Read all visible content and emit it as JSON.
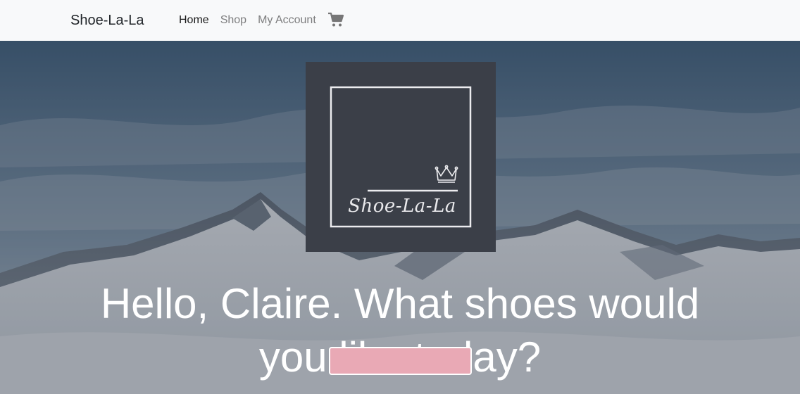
{
  "navbar": {
    "brand": "Shoe-La-La",
    "links": [
      {
        "label": "Home",
        "active": true
      },
      {
        "label": "Shop",
        "active": false
      },
      {
        "label": "My Account",
        "active": false
      }
    ],
    "cart_icon": "shopping-cart-icon"
  },
  "hero": {
    "logo": {
      "text": "Shoe-La-La",
      "icon": "crown-icon"
    },
    "greeting": "Hello, Claire. What shoes would you like today?",
    "cta_label": ""
  },
  "colors": {
    "navbar_bg": "#f8f9fa",
    "logo_bg": "#3b3f48",
    "cta_bg": "#e9a9b5"
  }
}
